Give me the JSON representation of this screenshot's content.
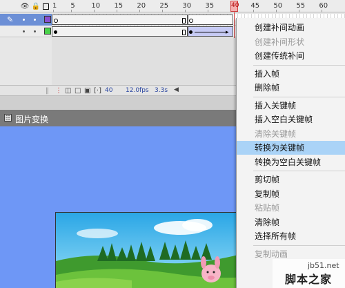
{
  "timeline": {
    "header_icons": [
      "eye-icon",
      "lock-icon",
      "outline-icon"
    ],
    "frame_numbers": [
      "1",
      "5",
      "10",
      "15",
      "20",
      "25",
      "30",
      "35",
      "40",
      "45",
      "50",
      "55",
      "60"
    ],
    "playhead_frame": "40",
    "layers": [
      {
        "color": "#8a4fd0",
        "selected": true,
        "icon": "pencil-icon"
      },
      {
        "color": "#49d24a",
        "selected": false
      }
    ],
    "status": {
      "current_frame": "40",
      "fps": "12.0fps",
      "time": "3.3s"
    }
  },
  "scene": {
    "label": "图片变换"
  },
  "context_menu": {
    "items": [
      {
        "label": "创建补间动画",
        "disabled": false,
        "highlighted": false
      },
      {
        "label": "创建补间形状",
        "disabled": true,
        "highlighted": false
      },
      {
        "label": "创建传统补间",
        "disabled": false,
        "highlighted": false
      },
      {
        "sep": true
      },
      {
        "label": "插入帧",
        "disabled": false,
        "highlighted": false
      },
      {
        "label": "删除帧",
        "disabled": false,
        "highlighted": false
      },
      {
        "sep": true
      },
      {
        "label": "插入关键帧",
        "disabled": false,
        "highlighted": false
      },
      {
        "label": "插入空白关键帧",
        "disabled": false,
        "highlighted": false
      },
      {
        "label": "清除关键帧",
        "disabled": true,
        "highlighted": false
      },
      {
        "label": "转换为关键帧",
        "disabled": false,
        "highlighted": true
      },
      {
        "label": "转换为空白关键帧",
        "disabled": false,
        "highlighted": false
      },
      {
        "sep": true
      },
      {
        "label": "剪切帧",
        "disabled": false,
        "highlighted": false
      },
      {
        "label": "复制帧",
        "disabled": false,
        "highlighted": false
      },
      {
        "label": "粘贴帧",
        "disabled": true,
        "highlighted": false
      },
      {
        "label": "清除帧",
        "disabled": false,
        "highlighted": false
      },
      {
        "label": "选择所有帧",
        "disabled": false,
        "highlighted": false
      },
      {
        "sep": true
      },
      {
        "label": "复制动画",
        "disabled": true,
        "highlighted": false
      }
    ]
  },
  "watermark": {
    "site": "jb51.net",
    "name": "脚本之家"
  }
}
